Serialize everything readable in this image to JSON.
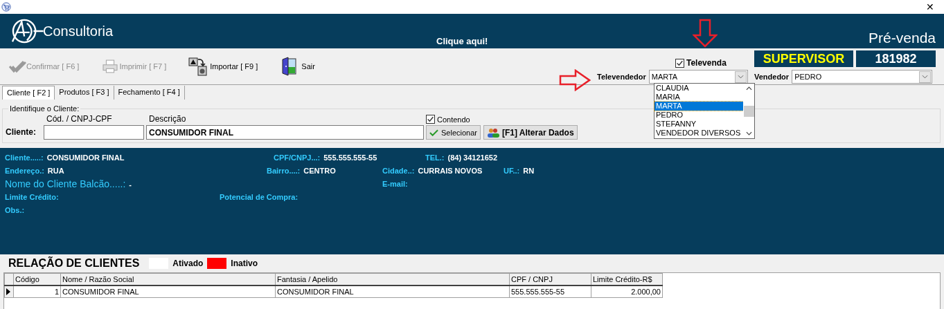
{
  "window": {
    "close": "✕"
  },
  "header": {
    "brand": "Consultoria",
    "link": "Clique aqui!",
    "title": "Pré-venda"
  },
  "toolbar": {
    "buttons": [
      {
        "kind": "confirm",
        "label": "Confirmar [ F6 ]",
        "disabled": true
      },
      {
        "kind": "print",
        "label": "Imprimir  [ F7 ]",
        "disabled": true
      },
      {
        "kind": "import",
        "label": "Importar [ F9 ]",
        "disabled": false
      },
      {
        "kind": "exit",
        "label": "Sair",
        "disabled": false
      }
    ],
    "televenda": {
      "label": "Televenda",
      "checked": true
    },
    "user_role": "SUPERVISOR",
    "user_code": "181982",
    "televendedor": {
      "label": "Televendedor",
      "value": "MARTA",
      "expanded": true,
      "options": [
        {
          "label": "CLAUDIA",
          "selected": false
        },
        {
          "label": "MARIA",
          "selected": false
        },
        {
          "label": "MARTA",
          "selected": true
        },
        {
          "label": "PEDRO",
          "selected": false
        },
        {
          "label": "STEFANNY",
          "selected": false
        },
        {
          "label": "VENDEDOR DIVERSOS",
          "selected": false
        }
      ]
    },
    "vendedor": {
      "label": "Vendedor",
      "value": "PEDRO"
    }
  },
  "tabs": [
    {
      "label": "Cliente [ F2 ]",
      "selected": true
    },
    {
      "label": "Produtos [ F3 ]",
      "selected": false
    },
    {
      "label": "Fechamento [ F4 ]",
      "selected": false
    }
  ],
  "client_search": {
    "group_label": "Identifique o Cliente:",
    "code_label": "Cód. / CNPJ-CPF",
    "desc_label": "Descrição",
    "field_label": "Cliente:",
    "desc_value": "CONSUMIDOR FINAL",
    "contendo": {
      "label": "Contendo",
      "checked": true
    },
    "select_button": "Selecionar",
    "edit_button": "[F1] Alterar Dados"
  },
  "info": {
    "rows": [
      [
        {
          "kind": "normal",
          "label": "Cliente.....:",
          "value": "CONSUMIDOR FINAL"
        },
        {
          "kind": "normal",
          "label": "CPF/CNPJ...:",
          "value": "555.555.555-55"
        },
        {
          "kind": "normal",
          "label": "TEL.:",
          "value": "(84) 34121652"
        }
      ],
      [
        {
          "kind": "normal",
          "label": "Endereço.:",
          "value": "RUA"
        },
        {
          "kind": "normal",
          "label": "Bairro....:",
          "value": "CENTRO"
        },
        {
          "kind": "normal",
          "label": "Cidade..:",
          "value": "CURRAIS NOVOS"
        },
        {
          "kind": "normal",
          "label": "UF..:",
          "value": "RN"
        }
      ],
      [
        {
          "kind": "large",
          "label": "Nome do Cliente Balcão.....:",
          "value": "-"
        },
        {
          "kind": "normal",
          "label": "E-mail:"
        }
      ],
      [
        {
          "kind": "normal",
          "label": "Limite Crédito:"
        },
        {
          "kind": "normal",
          "label": "Potencial de Compra:"
        }
      ],
      [
        {
          "kind": "normal",
          "label": "Obs.:"
        }
      ]
    ]
  },
  "legend": {
    "title": "RELAÇÃO DE CLIENTES",
    "items": [
      {
        "label": "Ativado",
        "color": "#ffffff"
      },
      {
        "label": "Inativo",
        "color": "#ff0000"
      }
    ]
  },
  "table": {
    "columns": [
      "Código",
      "Nome / Razão Social",
      "Fantasia / Apelido",
      "CPF / CNPJ",
      "Limite Crédito-R$"
    ],
    "rows": [
      {
        "selected": true,
        "cells": [
          "1",
          "CONSUMIDOR FINAL",
          "CONSUMIDOR FINAL",
          "555.555.555-55",
          "2.000,00"
        ]
      }
    ]
  }
}
